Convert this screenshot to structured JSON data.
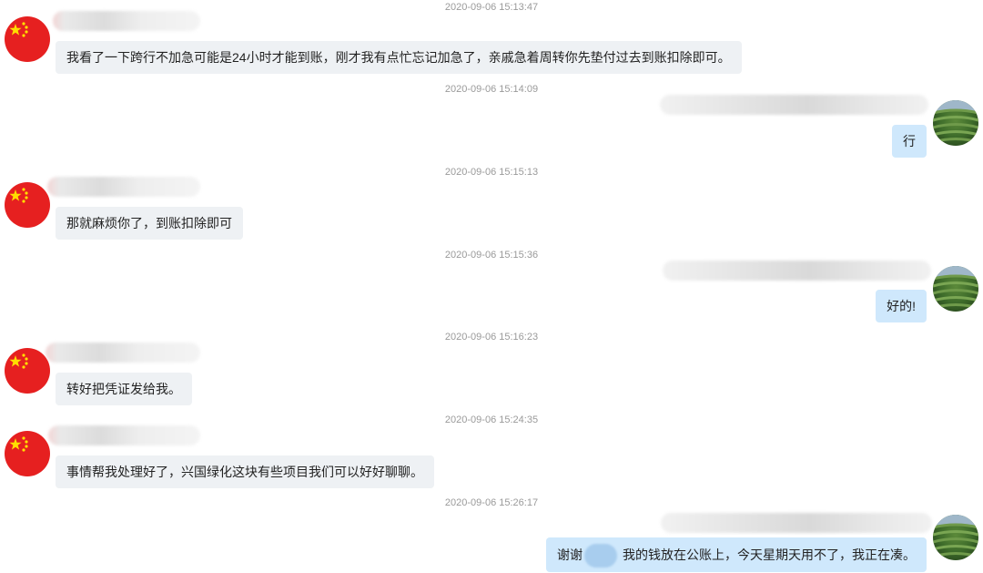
{
  "colors": {
    "incoming_bubble": "#eef1f4",
    "outgoing_bubble": "#cfe8fc",
    "timestamp": "#9a9a9a",
    "flag_red": "#e62020",
    "flag_star": "#ffde00"
  },
  "contact_avatar_icon": "china-flag-avatar",
  "self_avatar_icon": "tea-plantation-avatar",
  "messages": [
    {
      "time": "2020-09-06 15:13:47",
      "side": "in",
      "text": "我看了一下跨行不加急可能是24小时才能到账，刚才我有点忙忘记加急了，亲戚急着周转你先垫付过去到账扣除即可。"
    },
    {
      "time": "2020-09-06 15:14:09",
      "side": "out",
      "text": "行"
    },
    {
      "time": "2020-09-06 15:15:13",
      "side": "in",
      "text": "那就麻烦你了，到账扣除即可"
    },
    {
      "time": "2020-09-06 15:15:36",
      "side": "out",
      "text": "好的!"
    },
    {
      "time": "2020-09-06 15:16:23",
      "side": "in",
      "text": "转好把凭证发给我。"
    },
    {
      "time": "2020-09-06 15:24:35",
      "side": "in",
      "text": "事情帮我处理好了，兴国绿化这块有些项目我们可以好好聊聊。"
    },
    {
      "time": "2020-09-06 15:26:17",
      "side": "out",
      "text_prefix": "谢谢",
      "text": "我的钱放在公账上，今天星期天用不了，我正在凑。"
    }
  ]
}
